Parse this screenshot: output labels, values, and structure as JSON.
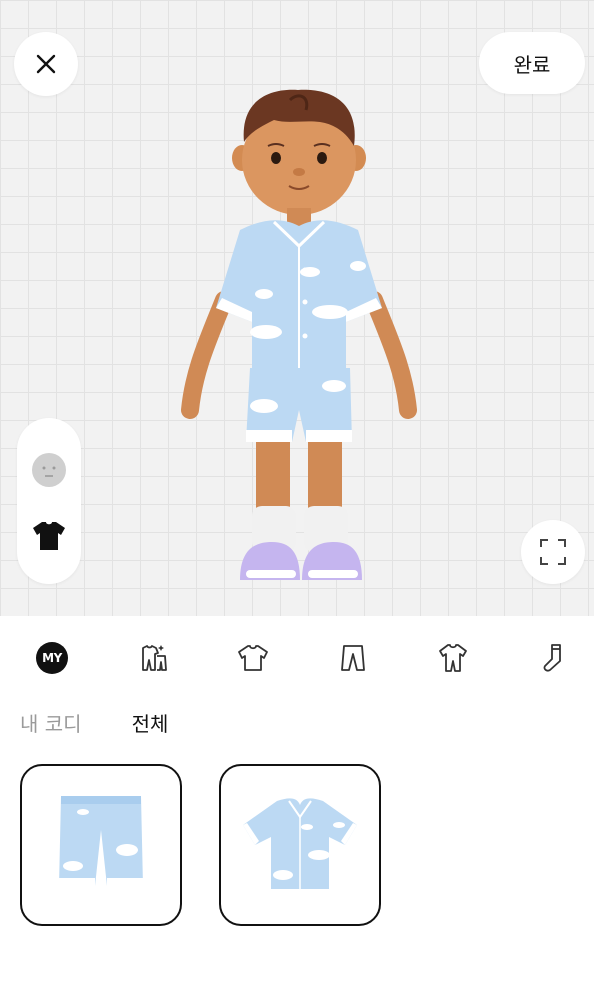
{
  "header": {
    "close_icon": "close-icon",
    "done_label": "완료"
  },
  "side_panel": {
    "items": [
      {
        "icon": "face-icon",
        "state": "inactive"
      },
      {
        "icon": "shirt-icon",
        "state": "active"
      }
    ]
  },
  "viewer": {
    "fullscreen_icon": "fullscreen-icon",
    "outfit_colors": {
      "pajama": "#bcd9f3",
      "cloud": "#ffffff",
      "sandal": "#c5b5ef",
      "skin": "#d9935a",
      "hair": "#6b3722"
    }
  },
  "categories": [
    {
      "id": "my",
      "label": "MY",
      "active": true
    },
    {
      "id": "set",
      "icon": "outfit-set-icon"
    },
    {
      "id": "top",
      "icon": "tshirt-icon"
    },
    {
      "id": "bottom",
      "icon": "pants-icon"
    },
    {
      "id": "onepiece",
      "icon": "jumpsuit-icon"
    },
    {
      "id": "socks",
      "icon": "sock-icon"
    }
  ],
  "subtabs": {
    "my_coordi": "내 코디",
    "all": "전체",
    "selected": "all"
  },
  "items": [
    {
      "name": "cloud-pajama-shorts"
    },
    {
      "name": "cloud-pajama-shirt"
    }
  ]
}
